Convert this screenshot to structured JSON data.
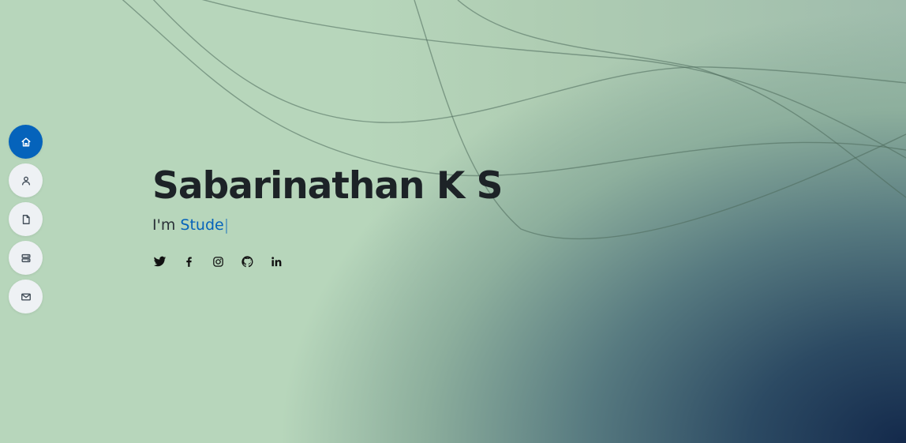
{
  "hero": {
    "name": "Sabarinathan K S",
    "subtitle_prefix": "I'm",
    "typed_text": "Stude",
    "cursor": "|"
  },
  "nav": {
    "items": [
      {
        "icon": "home-icon",
        "active": true
      },
      {
        "icon": "person-icon",
        "active": false
      },
      {
        "icon": "file-icon",
        "active": false
      },
      {
        "icon": "server-icon",
        "active": false
      },
      {
        "icon": "envelope-icon",
        "active": false
      }
    ]
  },
  "socials": [
    "twitter-icon",
    "facebook-icon",
    "instagram-icon",
    "github-icon",
    "linkedin-icon"
  ],
  "colors": {
    "accent": "#0563bb",
    "background_light": "#b7d6bb",
    "background_dark": "#13294b",
    "text_dark": "#1d2327"
  }
}
